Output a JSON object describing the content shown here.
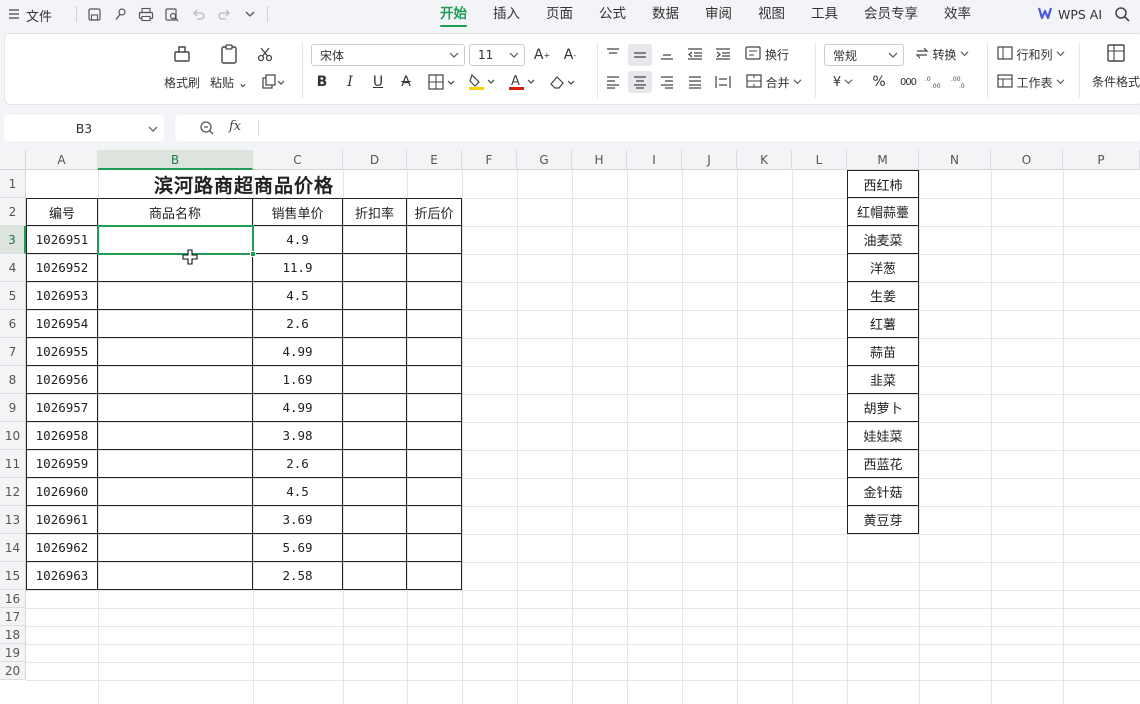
{
  "menubar": {
    "file_label": "文件",
    "tabs": [
      "开始",
      "插入",
      "页面",
      "公式",
      "数据",
      "审阅",
      "视图",
      "工具",
      "会员专享",
      "效率"
    ],
    "active_tab": "开始",
    "wps_ai_label": "WPS AI"
  },
  "ribbon": {
    "format_painter": "格式刷",
    "paste": "粘贴",
    "font_name": "宋体",
    "font_size": "11",
    "wrap_text": "换行",
    "merge": "合并",
    "number_format": "常规",
    "convert": "转换",
    "rows_cols": "行和列",
    "worksheet": "工作表",
    "conditional_format": "条件格式",
    "currency_symbol": "¥",
    "percent_symbol": "%"
  },
  "formula_bar": {
    "name_box": "B3",
    "fx": "fx",
    "formula": ""
  },
  "sheet": {
    "columns": [
      "A",
      "B",
      "C",
      "D",
      "E",
      "F",
      "G",
      "H",
      "I",
      "J",
      "K",
      "L",
      "M",
      "N",
      "O",
      "P"
    ],
    "rows": [
      "1",
      "2",
      "3",
      "4",
      "5",
      "6",
      "7",
      "8",
      "9",
      "10",
      "11",
      "12",
      "13",
      "14",
      "15",
      "16",
      "17",
      "18",
      "19",
      "20"
    ],
    "selected_column": "B",
    "selected_row": "3",
    "title": "滨河路商超商品价格",
    "headers": [
      "编号",
      "商品名称",
      "销售单价",
      "折扣率",
      "折后价"
    ],
    "table_rows": [
      {
        "id": "1026951",
        "name": "",
        "price": "4.9",
        "discount": "",
        "final": ""
      },
      {
        "id": "1026952",
        "name": "",
        "price": "11.9",
        "discount": "",
        "final": ""
      },
      {
        "id": "1026953",
        "name": "",
        "price": "4.5",
        "discount": "",
        "final": ""
      },
      {
        "id": "1026954",
        "name": "",
        "price": "2.6",
        "discount": "",
        "final": ""
      },
      {
        "id": "1026955",
        "name": "",
        "price": "4.99",
        "discount": "",
        "final": ""
      },
      {
        "id": "1026956",
        "name": "",
        "price": "1.69",
        "discount": "",
        "final": ""
      },
      {
        "id": "1026957",
        "name": "",
        "price": "4.99",
        "discount": "",
        "final": ""
      },
      {
        "id": "1026958",
        "name": "",
        "price": "3.98",
        "discount": "",
        "final": ""
      },
      {
        "id": "1026959",
        "name": "",
        "price": "2.6",
        "discount": "",
        "final": ""
      },
      {
        "id": "1026960",
        "name": "",
        "price": "4.5",
        "discount": "",
        "final": ""
      },
      {
        "id": "1026961",
        "name": "",
        "price": "3.69",
        "discount": "",
        "final": ""
      },
      {
        "id": "1026962",
        "name": "",
        "price": "5.69",
        "discount": "",
        "final": ""
      },
      {
        "id": "1026963",
        "name": "",
        "price": "2.58",
        "discount": "",
        "final": ""
      }
    ],
    "product_list": [
      "西红柿",
      "红帽蒜薹",
      "油麦菜",
      "洋葱",
      "生姜",
      "红薯",
      "蒜苗",
      "韭菜",
      "胡萝卜",
      "娃娃菜",
      "西蓝花",
      "金针菇",
      "黄豆芽"
    ]
  }
}
